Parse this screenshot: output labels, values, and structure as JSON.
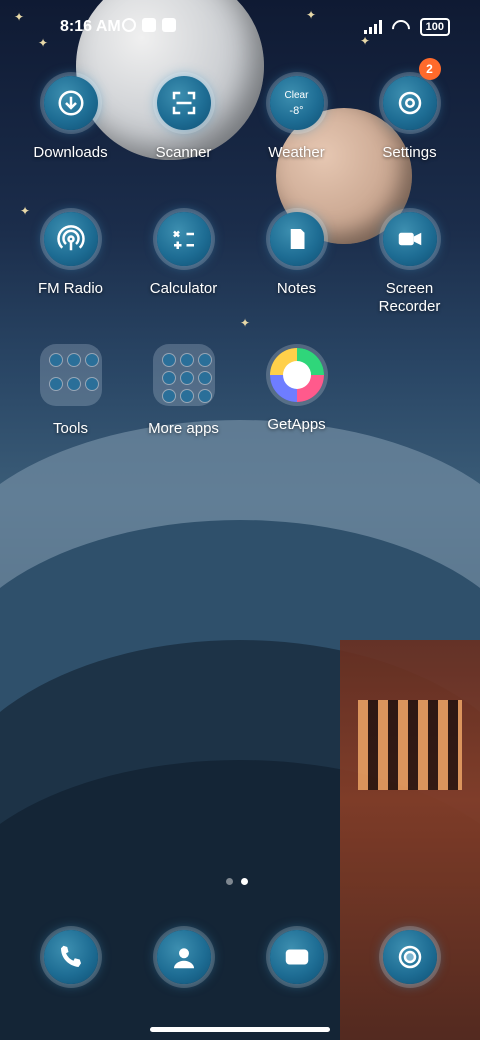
{
  "status_bar": {
    "time": "8:16 AM",
    "battery": "100"
  },
  "apps": [
    {
      "label": "Downloads",
      "icon": "download-icon"
    },
    {
      "label": "Scanner",
      "icon": "scanner-icon"
    },
    {
      "label": "Weather",
      "icon": "weather-icon",
      "weather_text": "Clear",
      "weather_temp": "-8°"
    },
    {
      "label": "Settings",
      "icon": "settings-icon",
      "badge": "2"
    },
    {
      "label": "FM Radio",
      "icon": "radio-icon"
    },
    {
      "label": "Calculator",
      "icon": "calculator-icon"
    },
    {
      "label": "Notes",
      "icon": "notes-icon"
    },
    {
      "label": "Screen Recorder",
      "icon": "screen-recorder-icon"
    },
    {
      "label": "Tools",
      "icon": "folder-icon"
    },
    {
      "label": "More apps",
      "icon": "folder-icon"
    },
    {
      "label": "GetApps",
      "icon": "getapps-icon"
    }
  ],
  "dock": [
    {
      "icon": "phone-icon"
    },
    {
      "icon": "contacts-icon"
    },
    {
      "icon": "messages-icon"
    },
    {
      "icon": "camera-icon"
    }
  ],
  "page_indicator": {
    "total": 2,
    "active": 1
  },
  "colors": {
    "accent": "#1e6d94",
    "badge": "#ff6a2b"
  }
}
